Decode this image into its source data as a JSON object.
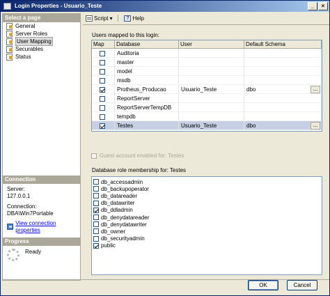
{
  "window": {
    "title": "Login Properties - Usuario_Teste"
  },
  "left": {
    "select_page_header": "Select a page",
    "pages": [
      {
        "label": "General",
        "selected": false
      },
      {
        "label": "Server Roles",
        "selected": false
      },
      {
        "label": "User Mapping",
        "selected": true
      },
      {
        "label": "Securables",
        "selected": false
      },
      {
        "label": "Status",
        "selected": false
      }
    ],
    "connection_header": "Connection",
    "server_label": "Server:",
    "server_value": "127.0.0.1",
    "connection_label": "Connection:",
    "connection_value": "DBA\\Win7Portable",
    "view_link": "View connection properties",
    "progress_header": "Progress",
    "progress_status": "Ready"
  },
  "toolbar": {
    "script_label": "Script",
    "help_label": "Help"
  },
  "users_mapped_label": "Users mapped to this login:",
  "grid": {
    "columns": [
      "Map",
      "Database",
      "User",
      "Default Schema"
    ],
    "rows": [
      {
        "map": false,
        "database": "Auditoria",
        "user": "",
        "schema": "",
        "selected": false
      },
      {
        "map": false,
        "database": "master",
        "user": "",
        "schema": "",
        "selected": false
      },
      {
        "map": false,
        "database": "model",
        "user": "",
        "schema": "",
        "selected": false
      },
      {
        "map": false,
        "database": "msdb",
        "user": "",
        "schema": "",
        "selected": false
      },
      {
        "map": true,
        "database": "Protheus_Producao",
        "user": "Usuario_Teste",
        "schema": "dbo",
        "selected": false
      },
      {
        "map": false,
        "database": "ReportServer",
        "user": "",
        "schema": "",
        "selected": false
      },
      {
        "map": false,
        "database": "ReportServerTempDB",
        "user": "",
        "schema": "",
        "selected": false
      },
      {
        "map": false,
        "database": "tempdb",
        "user": "",
        "schema": "",
        "selected": false
      },
      {
        "map": true,
        "database": "Testes",
        "user": "Usuario_Teste",
        "schema": "dbo",
        "selected": true
      }
    ],
    "ellipsis": "..."
  },
  "guest_label": "Guest account enabled for: Testes",
  "roles_label": "Database role membership for: Testes",
  "roles": [
    {
      "name": "db_accessadmin",
      "checked": false
    },
    {
      "name": "db_backupoperator",
      "checked": false
    },
    {
      "name": "db_datareader",
      "checked": false
    },
    {
      "name": "db_datawriter",
      "checked": false
    },
    {
      "name": "db_ddladmin",
      "checked": true
    },
    {
      "name": "db_denydatareader",
      "checked": false
    },
    {
      "name": "db_denydatawriter",
      "checked": false
    },
    {
      "name": "db_owner",
      "checked": false
    },
    {
      "name": "db_securityadmin",
      "checked": false
    },
    {
      "name": "public",
      "checked": true
    }
  ],
  "buttons": {
    "ok": "OK",
    "cancel": "Cancel"
  }
}
